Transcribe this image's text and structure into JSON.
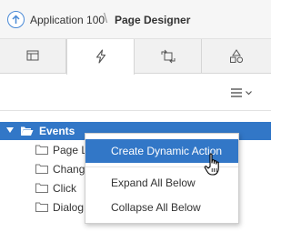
{
  "header": {
    "app_label": "Application 100",
    "separator": "\\",
    "page_label": "Page Designer"
  },
  "tabs": [
    {
      "icon": "layout-icon",
      "active": false
    },
    {
      "icon": "lightning-icon",
      "active": true
    },
    {
      "icon": "processing-icon",
      "active": false
    },
    {
      "icon": "shared-components-icon",
      "active": false
    }
  ],
  "toolbar": {
    "menu_icon": "hamburger-menu-icon"
  },
  "tree": {
    "root": {
      "label": "Events",
      "expanded": true,
      "selected": true
    },
    "children": [
      {
        "label": "Page L"
      },
      {
        "label": "Change"
      },
      {
        "label": "Click"
      },
      {
        "label": "Dialog C"
      }
    ]
  },
  "context_menu": {
    "items": [
      {
        "label": "Create Dynamic Action",
        "highlighted": true
      },
      {
        "label": "Expand All Below",
        "highlighted": false
      },
      {
        "label": "Collapse All Below",
        "highlighted": false
      }
    ]
  },
  "colors": {
    "accent": "#3277c7",
    "up_circle": "#4a8ad6"
  }
}
